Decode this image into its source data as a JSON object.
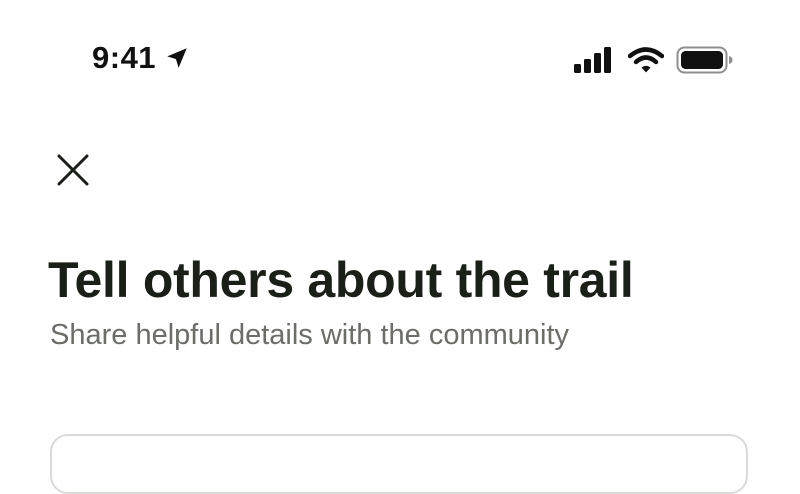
{
  "status_bar": {
    "time": "9:41",
    "icons": [
      "location-arrow-icon",
      "cellular-signal-icon",
      "wifi-icon",
      "battery-icon"
    ]
  },
  "header": {
    "close_icon": "close-icon"
  },
  "main": {
    "title": "Tell others about the trail",
    "subtitle": "Share helpful details with the community"
  },
  "colors": {
    "title": "#1a1f17",
    "subtitle": "#6a6d68",
    "card_border": "#d9dbd8",
    "background": "#ffffff"
  }
}
